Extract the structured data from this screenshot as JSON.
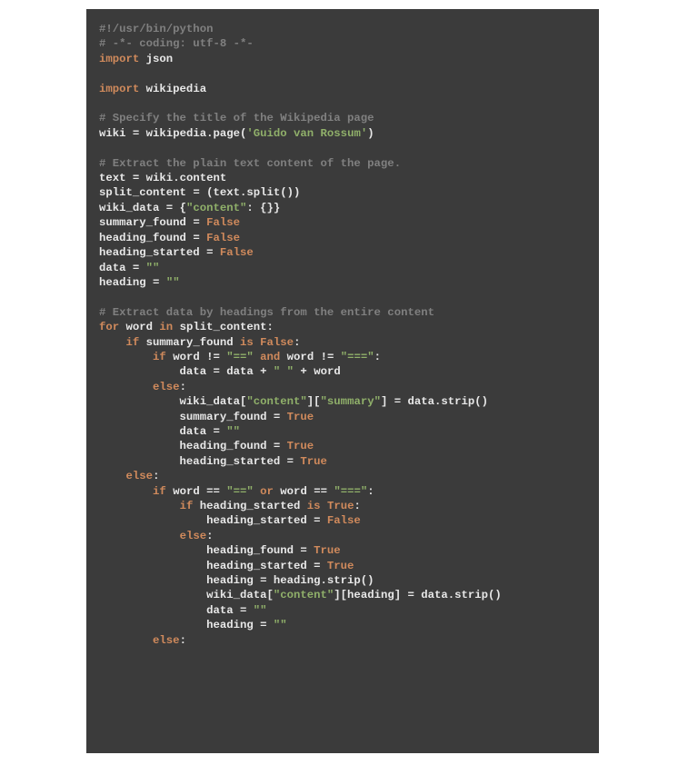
{
  "code": {
    "lines": [
      [
        [
          "c",
          "#!/usr/bin/python"
        ]
      ],
      [
        [
          "c",
          "# -*- coding: utf-8 -*-"
        ]
      ],
      [
        [
          "kw",
          "import"
        ],
        [
          "id",
          " json"
        ]
      ],
      [],
      [
        [
          "kw",
          "import"
        ],
        [
          "id",
          " wikipedia"
        ]
      ],
      [],
      [
        [
          "c",
          "# Specify the title of the Wikipedia page"
        ]
      ],
      [
        [
          "id",
          "wiki "
        ],
        [
          "op",
          "= "
        ],
        [
          "id",
          "wikipedia.page("
        ],
        [
          "s",
          "'Guido van Rossum'"
        ],
        [
          "id",
          ")"
        ]
      ],
      [],
      [
        [
          "c",
          "# Extract the plain text content of the page."
        ]
      ],
      [
        [
          "id",
          "text "
        ],
        [
          "op",
          "= "
        ],
        [
          "id",
          "wiki.content"
        ]
      ],
      [
        [
          "id",
          "split_content "
        ],
        [
          "op",
          "= "
        ],
        [
          "id",
          "(text.split())"
        ]
      ],
      [
        [
          "id",
          "wiki_data "
        ],
        [
          "op",
          "= "
        ],
        [
          "id",
          "{"
        ],
        [
          "s",
          "\"content\""
        ],
        [
          "id",
          ": {}}"
        ]
      ],
      [
        [
          "id",
          "summary_found "
        ],
        [
          "op",
          "= "
        ],
        [
          "kc",
          "False"
        ]
      ],
      [
        [
          "id",
          "heading_found "
        ],
        [
          "op",
          "= "
        ],
        [
          "kc",
          "False"
        ]
      ],
      [
        [
          "id",
          "heading_started "
        ],
        [
          "op",
          "= "
        ],
        [
          "kc",
          "False"
        ]
      ],
      [
        [
          "id",
          "data "
        ],
        [
          "op",
          "= "
        ],
        [
          "s",
          "\"\""
        ]
      ],
      [
        [
          "id",
          "heading "
        ],
        [
          "op",
          "= "
        ],
        [
          "s",
          "\"\""
        ]
      ],
      [],
      [
        [
          "c",
          "# Extract data by headings from the entire content"
        ]
      ],
      [
        [
          "kw",
          "for"
        ],
        [
          "id",
          " word "
        ],
        [
          "kw",
          "in"
        ],
        [
          "id",
          " split_content:"
        ]
      ],
      [
        [
          "id",
          "    "
        ],
        [
          "kw",
          "if"
        ],
        [
          "id",
          " summary_found "
        ],
        [
          "kw",
          "is"
        ],
        [
          "id",
          " "
        ],
        [
          "kc",
          "False"
        ],
        [
          "id",
          ":"
        ]
      ],
      [
        [
          "id",
          "        "
        ],
        [
          "kw",
          "if"
        ],
        [
          "id",
          " word "
        ],
        [
          "op",
          "!= "
        ],
        [
          "s",
          "\"==\""
        ],
        [
          "id",
          " "
        ],
        [
          "kw",
          "and"
        ],
        [
          "id",
          " word "
        ],
        [
          "op",
          "!= "
        ],
        [
          "s",
          "\"===\""
        ],
        [
          "id",
          ":"
        ]
      ],
      [
        [
          "id",
          "            data "
        ],
        [
          "op",
          "= "
        ],
        [
          "id",
          "data "
        ],
        [
          "op",
          "+ "
        ],
        [
          "s",
          "\" \""
        ],
        [
          "id",
          " "
        ],
        [
          "op",
          "+ "
        ],
        [
          "id",
          "word"
        ]
      ],
      [
        [
          "id",
          "        "
        ],
        [
          "kw",
          "else"
        ],
        [
          "id",
          ":"
        ]
      ],
      [
        [
          "id",
          "            wiki_data["
        ],
        [
          "s",
          "\"content\""
        ],
        [
          "id",
          "]["
        ],
        [
          "s",
          "\"summary\""
        ],
        [
          "id",
          "] "
        ],
        [
          "op",
          "= "
        ],
        [
          "id",
          "data.strip()"
        ]
      ],
      [
        [
          "id",
          "            summary_found "
        ],
        [
          "op",
          "= "
        ],
        [
          "kc",
          "True"
        ]
      ],
      [
        [
          "id",
          "            data "
        ],
        [
          "op",
          "= "
        ],
        [
          "s",
          "\"\""
        ]
      ],
      [
        [
          "id",
          "            heading_found "
        ],
        [
          "op",
          "= "
        ],
        [
          "kc",
          "True"
        ]
      ],
      [
        [
          "id",
          "            heading_started "
        ],
        [
          "op",
          "= "
        ],
        [
          "kc",
          "True"
        ]
      ],
      [
        [
          "id",
          "    "
        ],
        [
          "kw",
          "else"
        ],
        [
          "id",
          ":"
        ]
      ],
      [
        [
          "id",
          "        "
        ],
        [
          "kw",
          "if"
        ],
        [
          "id",
          " word "
        ],
        [
          "op",
          "== "
        ],
        [
          "s",
          "\"==\""
        ],
        [
          "id",
          " "
        ],
        [
          "kw",
          "or"
        ],
        [
          "id",
          " word "
        ],
        [
          "op",
          "== "
        ],
        [
          "s",
          "\"===\""
        ],
        [
          "id",
          ":"
        ]
      ],
      [
        [
          "id",
          "            "
        ],
        [
          "kw",
          "if"
        ],
        [
          "id",
          " heading_started "
        ],
        [
          "kw",
          "is"
        ],
        [
          "id",
          " "
        ],
        [
          "kc",
          "True"
        ],
        [
          "id",
          ":"
        ]
      ],
      [
        [
          "id",
          "                heading_started "
        ],
        [
          "op",
          "= "
        ],
        [
          "kc",
          "False"
        ]
      ],
      [
        [
          "id",
          "            "
        ],
        [
          "kw",
          "else"
        ],
        [
          "id",
          ":"
        ]
      ],
      [
        [
          "id",
          "                heading_found "
        ],
        [
          "op",
          "= "
        ],
        [
          "kc",
          "True"
        ]
      ],
      [
        [
          "id",
          "                heading_started "
        ],
        [
          "op",
          "= "
        ],
        [
          "kc",
          "True"
        ]
      ],
      [
        [
          "id",
          "                heading "
        ],
        [
          "op",
          "= "
        ],
        [
          "id",
          "heading.strip()"
        ]
      ],
      [
        [
          "id",
          "                wiki_data["
        ],
        [
          "s",
          "\"content\""
        ],
        [
          "id",
          "][heading] "
        ],
        [
          "op",
          "= "
        ],
        [
          "id",
          "data.strip()"
        ]
      ],
      [
        [
          "id",
          "                data "
        ],
        [
          "op",
          "= "
        ],
        [
          "s",
          "\"\""
        ]
      ],
      [
        [
          "id",
          "                heading "
        ],
        [
          "op",
          "= "
        ],
        [
          "s",
          "\"\""
        ]
      ],
      [
        [
          "id",
          "        "
        ],
        [
          "kw",
          "else"
        ],
        [
          "id",
          ":"
        ]
      ]
    ]
  }
}
